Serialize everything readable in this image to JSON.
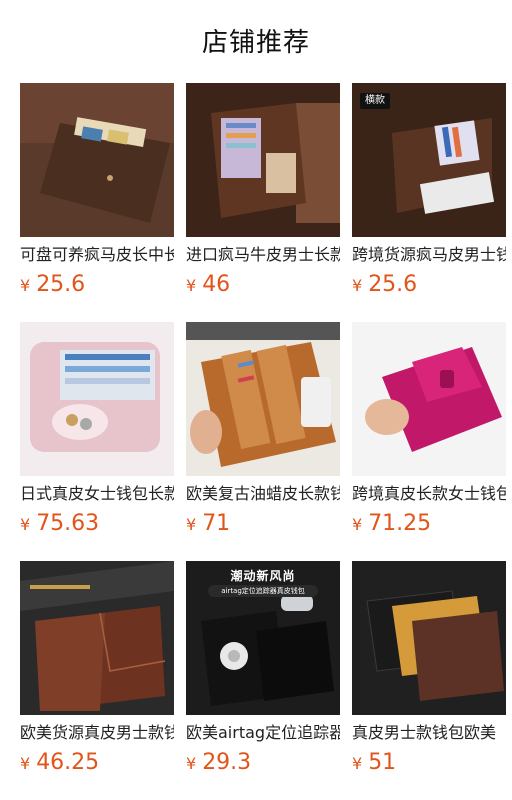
{
  "header": {
    "title": "店铺推荐"
  },
  "currency": "¥",
  "products": [
    {
      "name": "可盘可养疯马皮长中长款男士钱包",
      "price": "25.6",
      "tag": ""
    },
    {
      "name": "进口疯马牛皮男士长款钱包",
      "price": "46",
      "tag": ""
    },
    {
      "name": "跨境货源疯马皮男士钱包",
      "price": "25.6",
      "tag": "横款"
    },
    {
      "name": "日式真皮女士钱包长款",
      "price": "75.63",
      "tag": ""
    },
    {
      "name": "欧美复古油蜡皮长款钱包",
      "price": "71",
      "tag": ""
    },
    {
      "name": "跨境真皮长款女士钱包",
      "price": "71.25",
      "tag": ""
    },
    {
      "name": "欧美货源真皮男士款钱包",
      "price": "46.25",
      "tag": ""
    },
    {
      "name": "欧美airtag定位追踪器钱包",
      "price": "29.3",
      "tag": "",
      "promo_title": "潮动新风尚",
      "promo_sub": "airtag定位追踪器真皮钱包"
    },
    {
      "name": "真皮男士款钱包欧美",
      "price": "51",
      "tag": ""
    }
  ]
}
